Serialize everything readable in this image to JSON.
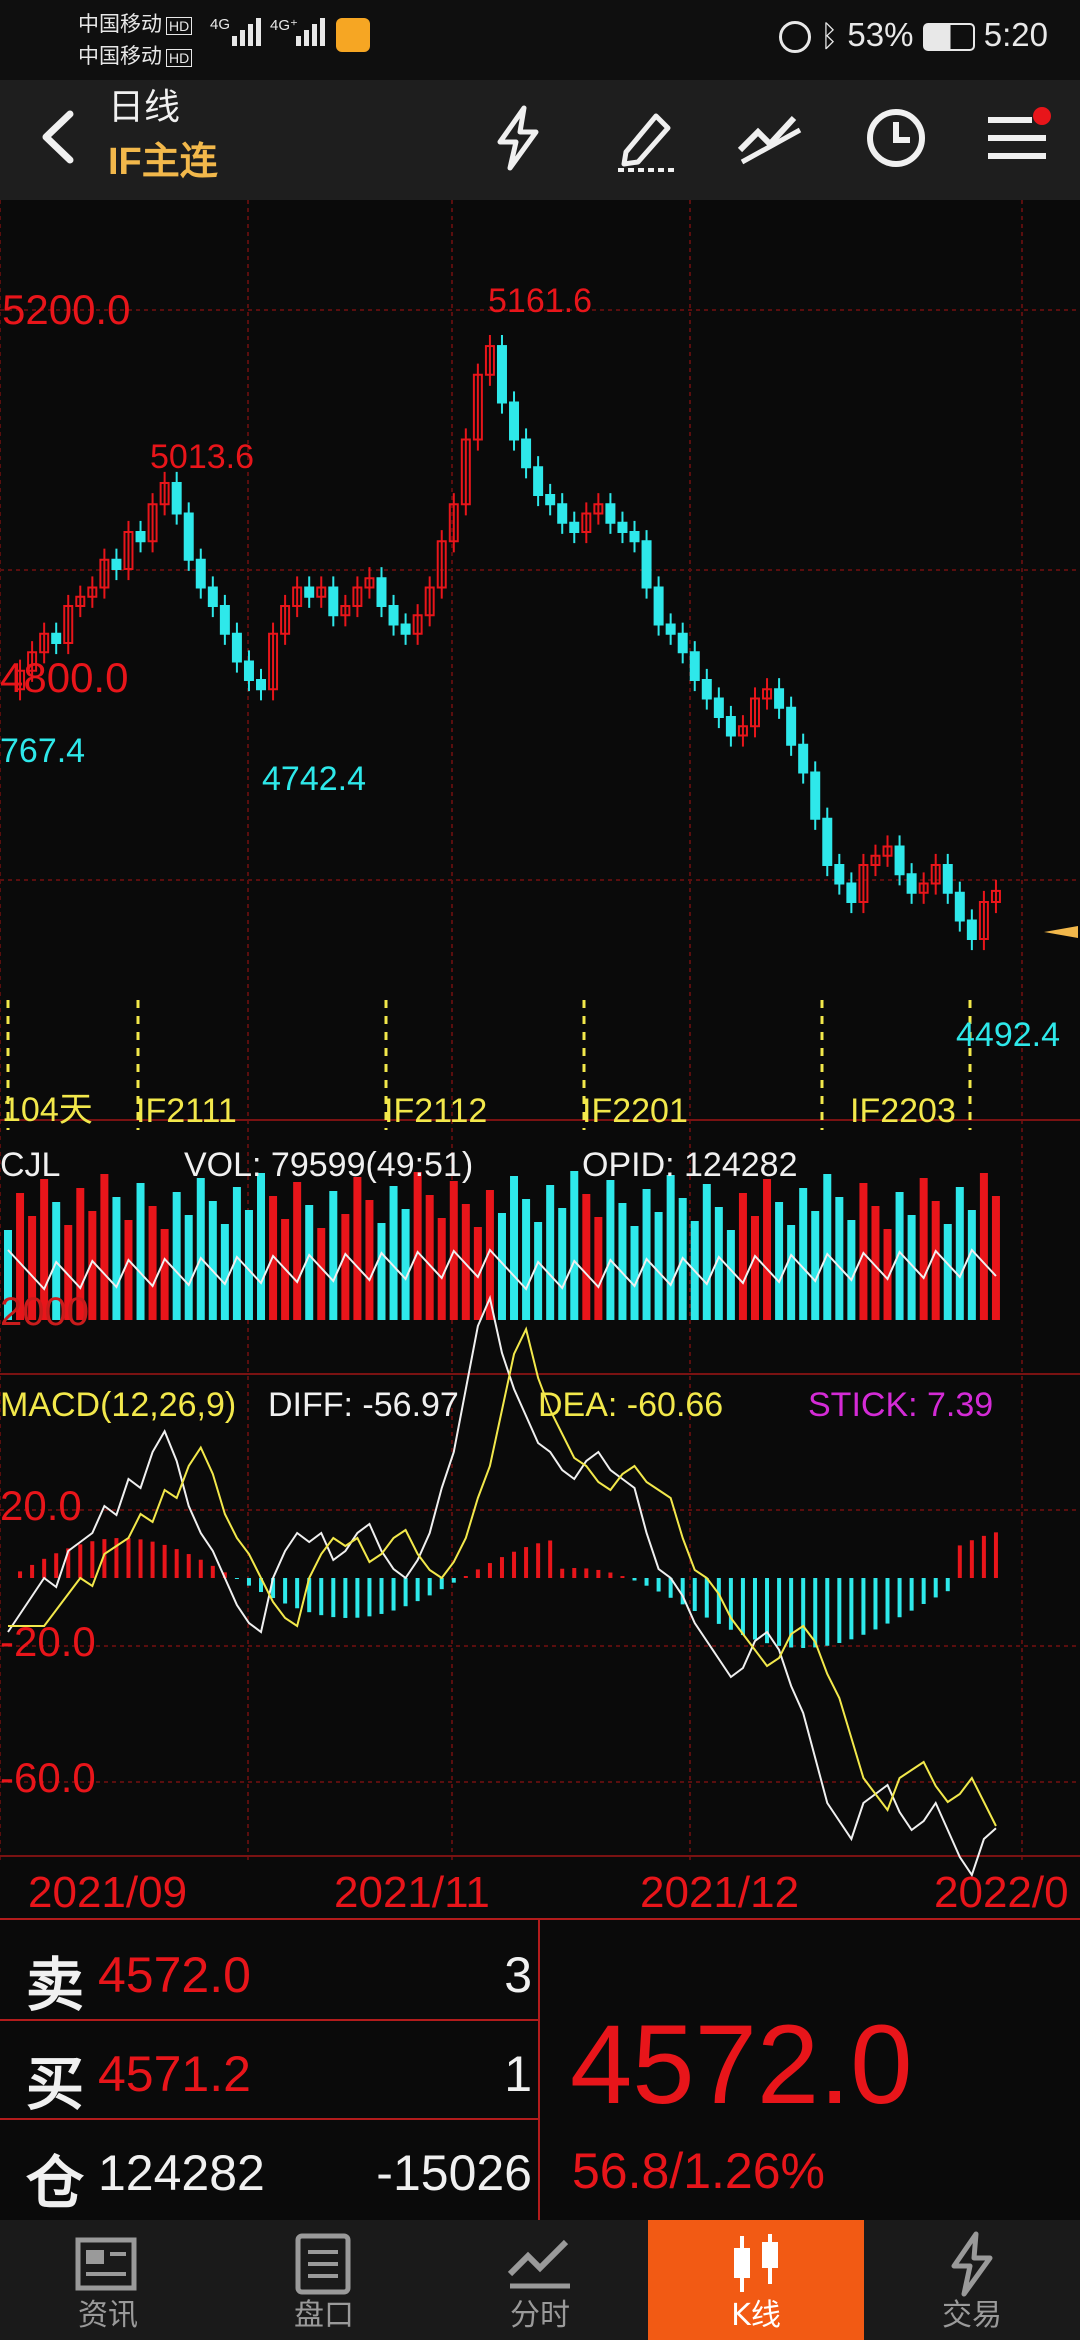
{
  "status_bar": {
    "carrier1": "中国移动",
    "carrier2": "中国移动",
    "hd": "HD",
    "net1": "4G",
    "net2": "4G⁺",
    "battery": "53%",
    "time": "5:20"
  },
  "header": {
    "title": "日线",
    "subtitle": "IF主连"
  },
  "toolbar_icons": [
    "lightning-icon",
    "pen-icon",
    "line-draw-icon",
    "clock-icon",
    "menu-icon"
  ],
  "kline": {
    "price_labels": {
      "p5200": "5200.0",
      "p4800": "4800.0"
    },
    "annotations": {
      "max": "5161.6",
      "local_high": "5013.6",
      "local_low": "4742.4",
      "left_low": "767.4",
      "min": "4492.4"
    },
    "contracts": [
      "104天",
      "IF2111",
      "IF2112",
      "IF2201",
      "IF2203"
    ]
  },
  "volume": {
    "label": "CJL",
    "vol": "VOL: 79599(49:51)",
    "opid": "OPID: 124282",
    "axis": "2000"
  },
  "macd": {
    "label": "MACD(12,26,9)",
    "diff": "DIFF: -56.97",
    "dea": "DEA: -60.66",
    "stick": "STICK: 7.39",
    "axis": [
      "20.0",
      "-20.0",
      "-60.0"
    ]
  },
  "x_axis": [
    "2021/09",
    "2021/11",
    "2021/12",
    "2022/0"
  ],
  "quote": {
    "sell_label": "卖",
    "sell_price": "4572.0",
    "sell_vol": "3",
    "buy_label": "买",
    "buy_price": "4571.2",
    "buy_vol": "1",
    "oi_label": "仓",
    "oi": "124282",
    "oi_change": "-15026",
    "last": "4572.0",
    "change": "56.8/1.26%"
  },
  "tabs": [
    {
      "label": "资讯",
      "icon": "news-icon"
    },
    {
      "label": "盘口",
      "icon": "orderbook-icon"
    },
    {
      "label": "分时",
      "icon": "intraday-icon"
    },
    {
      "label": "K线",
      "icon": "candlestick-icon",
      "active": true
    },
    {
      "label": "交易",
      "icon": "trade-icon"
    }
  ],
  "colors": {
    "up": "#e8151a",
    "down": "#2ee8ea",
    "accent": "#f25a14",
    "yellow": "#f2e84b",
    "magenta": "#d42bd6"
  }
}
